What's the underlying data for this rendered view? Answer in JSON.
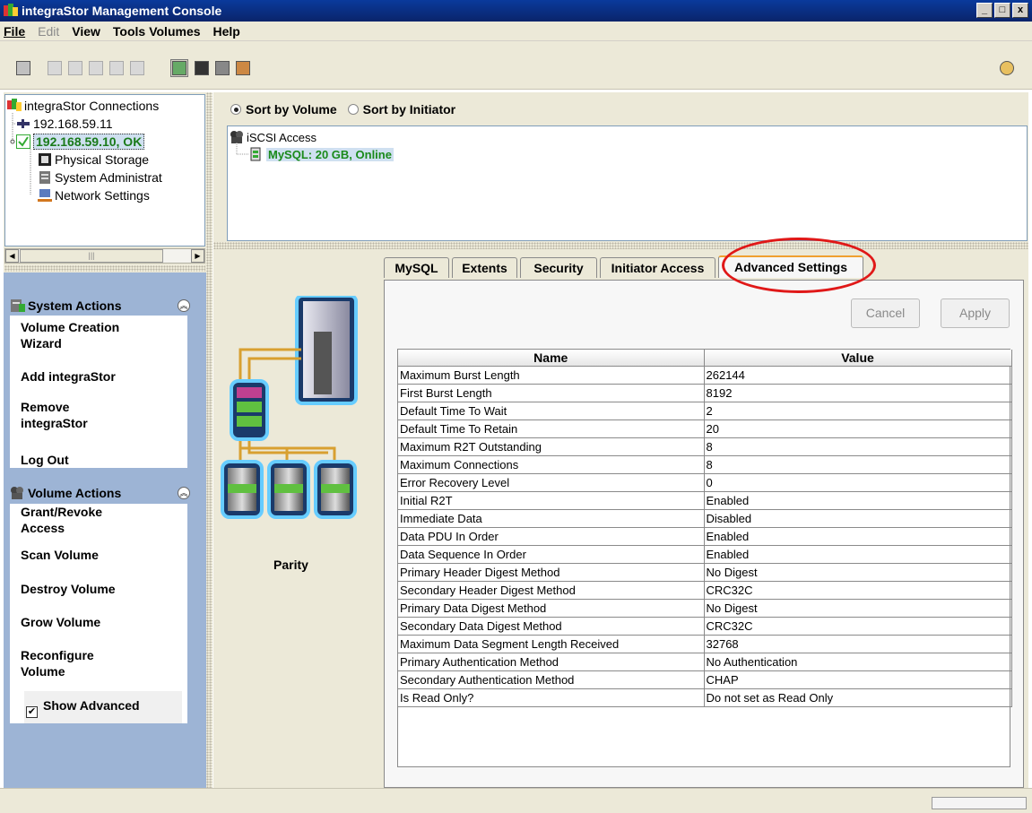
{
  "window": {
    "title": "integraStor Management Console",
    "controls": [
      "_",
      "□",
      "x"
    ]
  },
  "menu": {
    "items": [
      {
        "label": "File",
        "enabled": true
      },
      {
        "label": "Edit",
        "enabled": false
      },
      {
        "label": "View",
        "enabled": true
      },
      {
        "label": "Tools",
        "enabled": true
      },
      {
        "label": "Volumes",
        "enabled": true
      },
      {
        "label": "Help",
        "enabled": true
      }
    ]
  },
  "toolbar": {
    "icons": [
      "panel-icon",
      "cut-icon",
      "copy-icon",
      "paste-icon",
      "undo-icon",
      "redo-icon",
      "iscsi-access-icon",
      "physical-storage-icon",
      "system-admin-icon",
      "network-icon",
      "help-icon"
    ]
  },
  "connections": {
    "root": "integraStor Connections",
    "nodes": [
      {
        "label": "192.168.59.11",
        "status": ""
      },
      {
        "label": "192.168.59.10, OK",
        "status": "ok"
      }
    ],
    "children": [
      "Physical Storage",
      "System Administrat",
      "Network Settings"
    ]
  },
  "system_actions": {
    "title": "System Actions",
    "items": [
      "Volume Creation\nWizard",
      "Add integraStor",
      "Remove\nintegraStor",
      "Log Out"
    ]
  },
  "volume_actions": {
    "title": "Volume Actions",
    "items": [
      "Grant/Revoke\nAccess",
      "Scan Volume",
      "Destroy Volume",
      "Grow Volume",
      "Reconfigure\nVolume"
    ],
    "checkbox_label": "Show Advanced",
    "checkbox_checked": true
  },
  "sort": {
    "by_volume": "Sort by Volume",
    "by_initiator": "Sort by Initiator",
    "selected": "by_volume"
  },
  "volume_tree": {
    "root": "iSCSI Access",
    "child": "MySQL: 20 GB, Online"
  },
  "tabs": [
    "MySQL",
    "Extents",
    "Security",
    "Initiator Access",
    "Advanced Settings"
  ],
  "active_tab": "Advanced Settings",
  "buttons": {
    "cancel": "Cancel",
    "apply": "Apply"
  },
  "graphic_label": "Parity",
  "settings": {
    "columns": [
      "Name",
      "Value"
    ],
    "rows": [
      [
        "Maximum Burst Length",
        "262144"
      ],
      [
        "First Burst Length",
        "8192"
      ],
      [
        "Default Time To Wait",
        "2"
      ],
      [
        "Default Time To Retain",
        "20"
      ],
      [
        "Maximum R2T Outstanding",
        "8"
      ],
      [
        "Maximum Connections",
        "8"
      ],
      [
        "Error Recovery Level",
        "0"
      ],
      [
        "Initial R2T",
        "Enabled"
      ],
      [
        "Immediate Data",
        "Disabled"
      ],
      [
        "Data PDU In Order",
        "Enabled"
      ],
      [
        "Data Sequence In Order",
        "Enabled"
      ],
      [
        "Primary Header Digest Method",
        "No Digest"
      ],
      [
        "Secondary Header Digest Method",
        "CRC32C"
      ],
      [
        "Primary Data Digest Method",
        "No Digest"
      ],
      [
        "Secondary Data Digest Method",
        "CRC32C"
      ],
      [
        "Maximum Data Segment Length Received",
        "32768"
      ],
      [
        "Primary Authentication Method",
        "No Authentication"
      ],
      [
        "Secondary Authentication Method",
        "CHAP"
      ],
      [
        "Is Read Only?",
        "Do not set as Read Only"
      ]
    ]
  },
  "colors": {
    "title_bar": "#0a246a",
    "ok_green": "#1a9a1a",
    "panel_blue": "#9db4d5",
    "highlight": "#e01818"
  }
}
